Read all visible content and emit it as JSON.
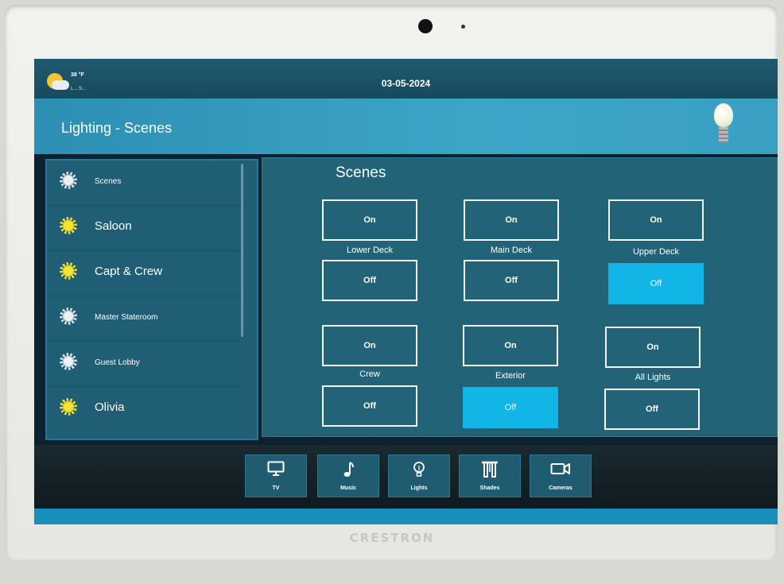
{
  "device": {
    "brand": "CRESTRON"
  },
  "status_bar": {
    "weather_icon": "partly-cloudy-icon",
    "temperature": "38 °F",
    "weather_detail": "L... S...",
    "date": "03-05-2024"
  },
  "header": {
    "title": "Lighting - Scenes",
    "icon": "light-bulb-icon"
  },
  "sidebar": {
    "items": [
      {
        "label": "Scenes",
        "state": "off",
        "size": "small"
      },
      {
        "label": "Saloon",
        "state": "on",
        "size": "large"
      },
      {
        "label": "Capt & Crew",
        "state": "on",
        "size": "large"
      },
      {
        "label": "Master Stateroom",
        "state": "off",
        "size": "small"
      },
      {
        "label": "Guest Lobby",
        "state": "off",
        "size": "small"
      },
      {
        "label": "Olivia",
        "state": "on",
        "size": "large"
      }
    ]
  },
  "scenes": {
    "title": "Scenes",
    "groups": [
      {
        "label": "Lower Deck",
        "on_label": "On",
        "off_label": "Off",
        "active": "none"
      },
      {
        "label": "Main Deck",
        "on_label": "On",
        "off_label": "Off",
        "active": "none"
      },
      {
        "label": "Upper Deck",
        "on_label": "On",
        "off_label": "Off",
        "active": "off"
      },
      {
        "label": "Crew",
        "on_label": "On",
        "off_label": "Off",
        "active": "none"
      },
      {
        "label": "Exterior",
        "on_label": "On",
        "off_label": "Off",
        "active": "off"
      },
      {
        "label": "All Lights",
        "on_label": "On",
        "off_label": "Off",
        "active": "none"
      }
    ]
  },
  "navbar": {
    "items": [
      {
        "label": "TV",
        "icon": "tv-icon"
      },
      {
        "label": "Music",
        "icon": "music-note-icon"
      },
      {
        "label": "Lights",
        "icon": "light-bulb-icon"
      },
      {
        "label": "Shades",
        "icon": "shades-icon"
      },
      {
        "label": "Cameras",
        "icon": "camera-icon"
      }
    ]
  },
  "colors": {
    "active_button": "#11b6e6",
    "on_bulb": "#f3e43a",
    "header": "#2c8fb3"
  }
}
